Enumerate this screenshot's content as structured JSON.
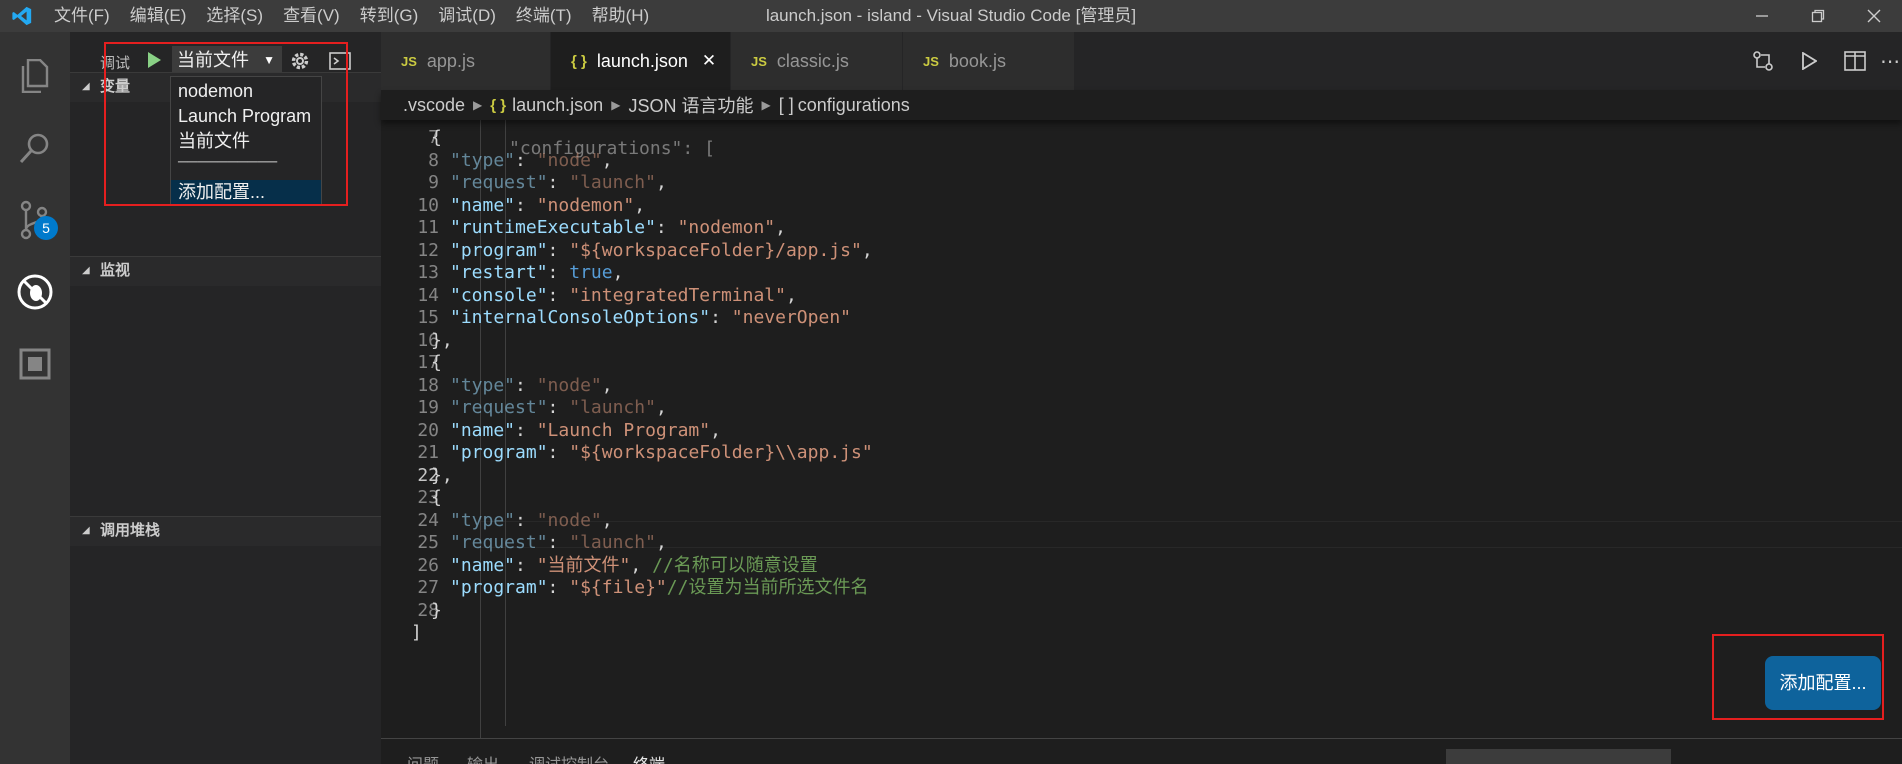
{
  "titlebar": {
    "title": "launch.json - island - Visual Studio Code [管理员]",
    "menu": [
      "文件(F)",
      "编辑(E)",
      "选择(S)",
      "查看(V)",
      "转到(G)",
      "调试(D)",
      "终端(T)",
      "帮助(H)"
    ]
  },
  "activity": {
    "scm_badge": "5"
  },
  "sidebar": {
    "title": "调试",
    "config_selected": "当前文件",
    "sections": {
      "variables": "变量",
      "watch": "监视",
      "callstack": "调用堆栈"
    }
  },
  "dropdown": {
    "items": [
      "nodemon",
      "Launch Program",
      "当前文件"
    ],
    "separator": "──────────",
    "add": "添加配置..."
  },
  "tabs": [
    {
      "label": "app.js",
      "icon": "JS"
    },
    {
      "label": "launch.json",
      "icon": "{ }",
      "active": true
    },
    {
      "label": "classic.js",
      "icon": "JS"
    },
    {
      "label": "book.js",
      "icon": "JS"
    }
  ],
  "breadcrumb": {
    "folder": ".vscode",
    "file": "launch.json",
    "lang": "JSON 语言功能",
    "node": "configurations",
    "node_icon": "[ ]"
  },
  "editor": {
    "partial_top": "\"configurations\": [",
    "partial_bottom": "]",
    "lines": [
      {
        "n": "7",
        "t": "{"
      },
      {
        "n": "8",
        "t": "\"type\": \"node\","
      },
      {
        "n": "9",
        "t": "\"request\": \"launch\","
      },
      {
        "n": "10",
        "t": "\"name\": \"nodemon\","
      },
      {
        "n": "11",
        "t": "\"runtimeExecutable\": \"nodemon\","
      },
      {
        "n": "12",
        "t": "\"program\": \"${workspaceFolder}/app.js\","
      },
      {
        "n": "13",
        "t": "\"restart\": true,"
      },
      {
        "n": "14",
        "t": "\"console\": \"integratedTerminal\","
      },
      {
        "n": "15",
        "t": "\"internalConsoleOptions\": \"neverOpen\""
      },
      {
        "n": "16",
        "t": "},"
      },
      {
        "n": "17",
        "t": "{"
      },
      {
        "n": "18",
        "t": "\"type\": \"node\","
      },
      {
        "n": "19",
        "t": "\"request\": \"launch\","
      },
      {
        "n": "20",
        "t": "\"name\": \"Launch Program\","
      },
      {
        "n": "21",
        "t": "\"program\": \"${workspaceFolder}\\\\app.js\""
      },
      {
        "n": "22",
        "t": "},"
      },
      {
        "n": "23",
        "t": "{"
      },
      {
        "n": "24",
        "t": "\"type\": \"node\","
      },
      {
        "n": "25",
        "t": "\"request\": \"launch\","
      },
      {
        "n": "26",
        "t": "\"name\": \"当前文件\", //名称可以随意设置"
      },
      {
        "n": "27",
        "t": "\"program\": \"${file}\"//设置为当前所选文件名"
      },
      {
        "n": "28",
        "t": "}"
      }
    ]
  },
  "panel": {
    "tabs": [
      "问题",
      "输出",
      "调试控制台",
      "终端"
    ]
  },
  "add_config_button": "添加配置...",
  "colors": {
    "accent": "#007acc",
    "button": "#0e639c",
    "highlight": "#e51f1f"
  }
}
